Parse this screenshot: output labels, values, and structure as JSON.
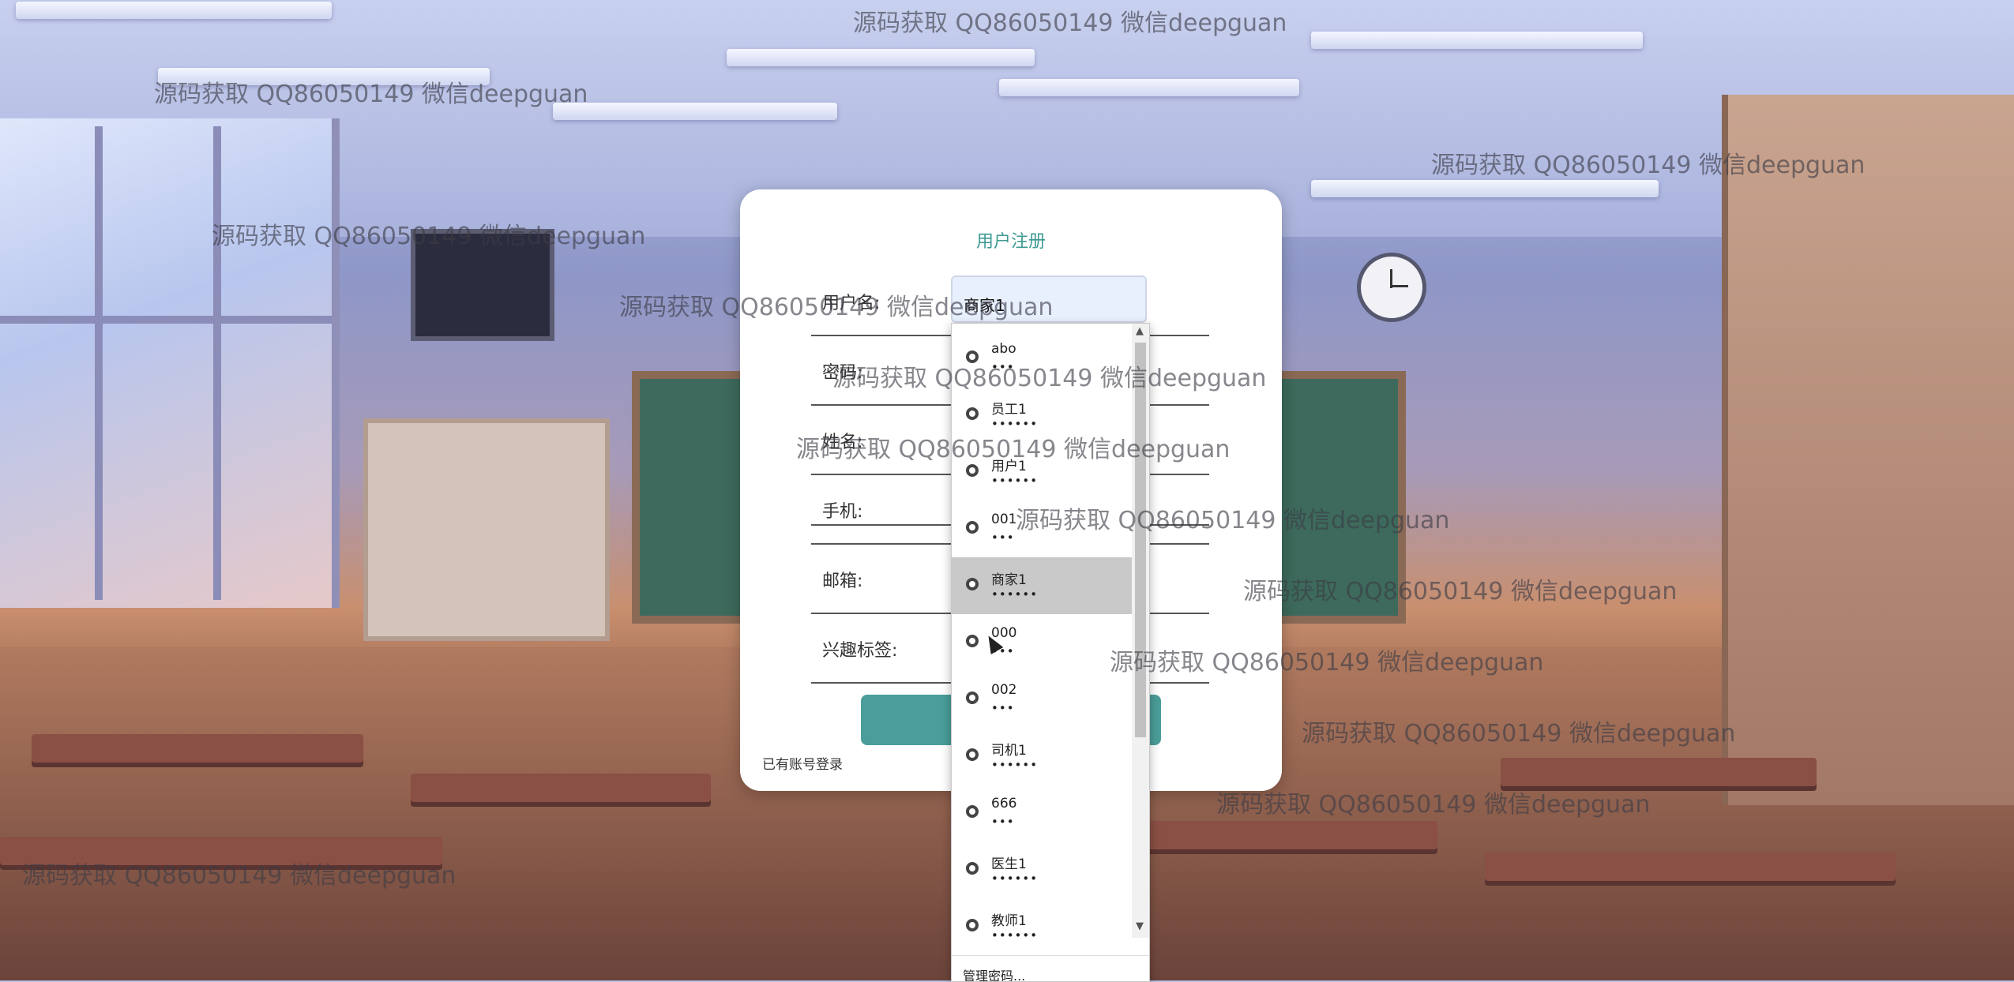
{
  "form": {
    "title": "用户注册",
    "fields": [
      {
        "label": "用户名:",
        "value": "商家1"
      },
      {
        "label": "密码:"
      },
      {
        "label": "姓名:"
      },
      {
        "label": "手机:"
      },
      {
        "label": "邮箱:"
      },
      {
        "label": "兴趣标签:"
      }
    ],
    "login_link": "已有账号登录"
  },
  "autofill": {
    "items": [
      {
        "name": "abo",
        "password": "•••"
      },
      {
        "name": "员工1",
        "password": "••••••"
      },
      {
        "name": "用户1",
        "password": "••••••"
      },
      {
        "name": "001",
        "password": "•••"
      },
      {
        "name": "商家1",
        "password": "••••••",
        "active": true
      },
      {
        "name": "000",
        "password": "•••"
      },
      {
        "name": "002",
        "password": "•••"
      },
      {
        "name": "司机1",
        "password": "••••••"
      },
      {
        "name": "666",
        "password": "•••"
      },
      {
        "name": "医生1",
        "password": "••••••"
      },
      {
        "name": "教师1",
        "password": "••••••"
      }
    ],
    "footer": "管理密码..."
  },
  "watermark_text": "源码获取 QQ86050149 微信deepguan",
  "colors": {
    "accent": "#4a9d9a",
    "title": "#3d9a93",
    "active_item": "#c9c9c9"
  }
}
